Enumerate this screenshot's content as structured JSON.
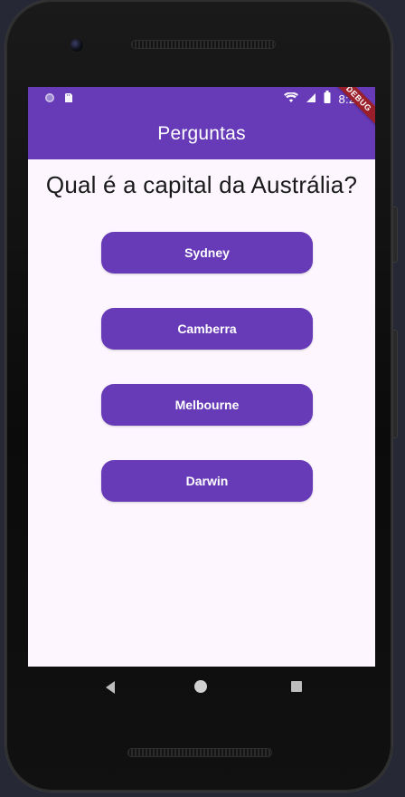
{
  "status_bar": {
    "time": "8:27",
    "left_icons": [
      "circle-icon",
      "sd-card-icon"
    ],
    "right_icons": [
      "wifi-icon",
      "signal-icon",
      "battery-icon"
    ]
  },
  "app_bar": {
    "title": "Perguntas"
  },
  "debug_banner": {
    "text": "DEBUG"
  },
  "quiz": {
    "question": "Qual é a capital da Austrália?",
    "answers": [
      {
        "label": "Sydney"
      },
      {
        "label": "Camberra"
      },
      {
        "label": "Melbourne"
      },
      {
        "label": "Darwin"
      }
    ]
  },
  "theme": {
    "primary": "#673ab7",
    "background": "#fdf6ff",
    "debug_ribbon": "#9b1f2b"
  },
  "navigation_bar": {
    "icons": [
      "back-icon",
      "home-icon",
      "recents-icon"
    ]
  }
}
